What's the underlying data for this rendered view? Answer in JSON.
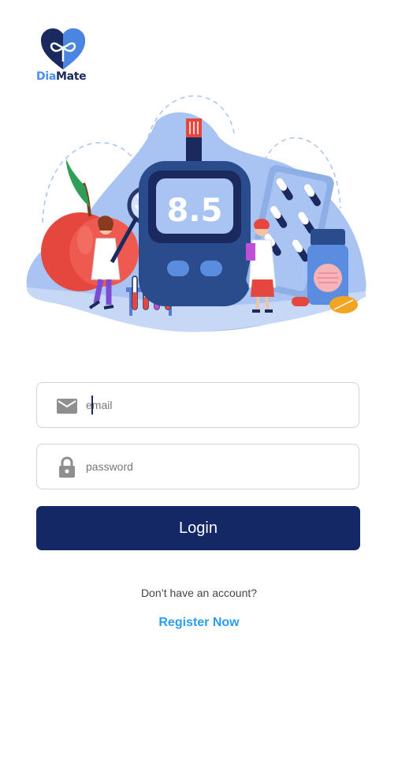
{
  "app": {
    "logo_part1": "Dia",
    "logo_part2": "Mate"
  },
  "hero": {
    "meter_reading": "8.5"
  },
  "form": {
    "email_placeholder": "email",
    "password_placeholder": "password",
    "login_label": "Login"
  },
  "footer": {
    "no_account_text": "Don’t have an account?",
    "register_label": "Register Now"
  },
  "colors": {
    "primary": "#142866",
    "link": "#2a9df4",
    "logo_light": "#4f8ff0",
    "logo_dark": "#1b2a5e",
    "border": "#d3d3d3"
  },
  "icons": {
    "email": "mail-icon",
    "password": "lock-icon"
  }
}
